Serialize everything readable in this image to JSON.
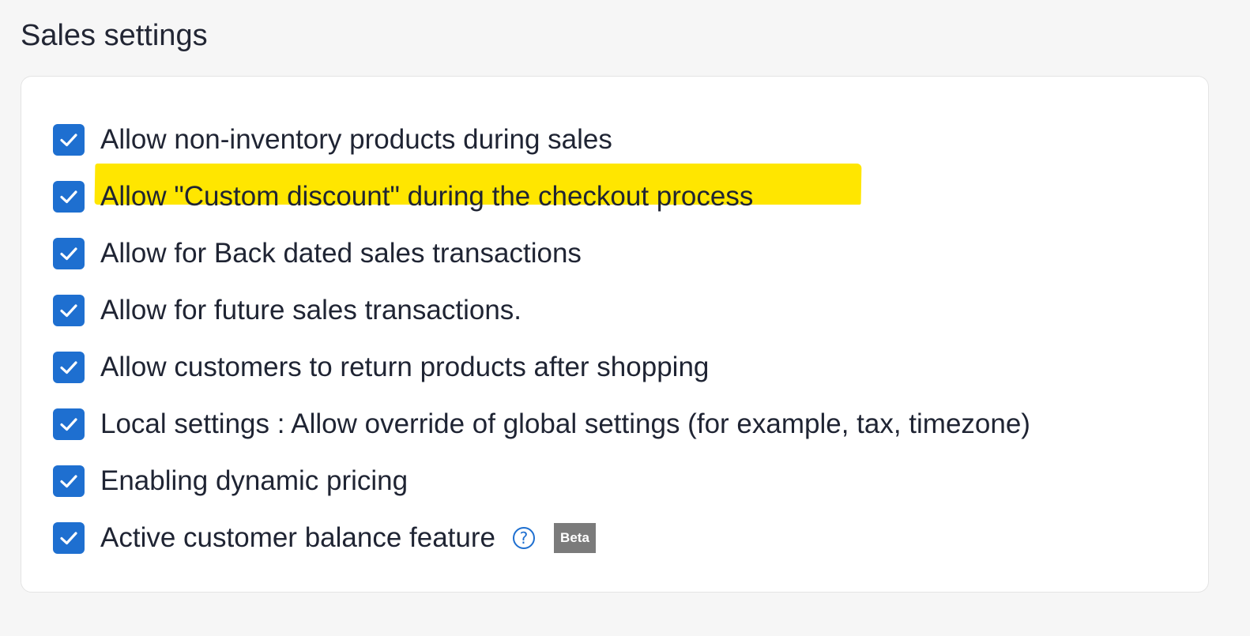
{
  "page": {
    "title": "Sales settings"
  },
  "settings": {
    "options": [
      {
        "label": "Allow non-inventory products during sales",
        "checked": true
      },
      {
        "label": "Allow \"Custom discount\" during the checkout process",
        "checked": true,
        "highlighted": true
      },
      {
        "label": "Allow for Back dated sales transactions",
        "checked": true
      },
      {
        "label": "Allow for future sales transactions.",
        "checked": true
      },
      {
        "label": "Allow customers to return products after shopping",
        "checked": true
      },
      {
        "label": "Local settings : Allow override of global settings (for example, tax, timezone)",
        "checked": true
      },
      {
        "label": "Enabling dynamic pricing",
        "checked": true
      },
      {
        "label": "Active customer balance feature",
        "checked": true,
        "help_icon": "question-circle-icon",
        "badge": "Beta"
      }
    ]
  },
  "colors": {
    "checkbox": "#1e6fd0",
    "highlight": "#ffe600",
    "badge": "#7b7b7b"
  }
}
